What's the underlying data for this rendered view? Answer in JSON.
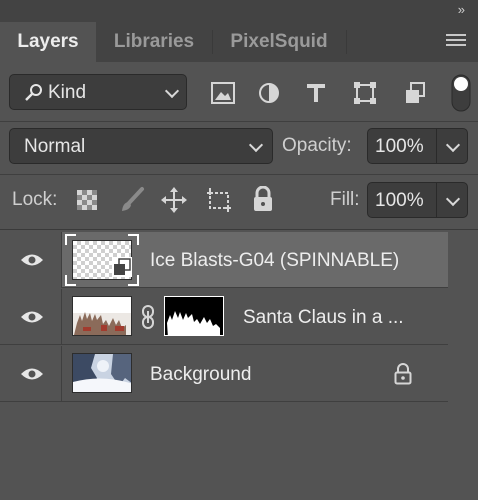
{
  "panel": {
    "collapse_glyph": "»",
    "tabs": [
      {
        "label": "Layers",
        "active": true
      },
      {
        "label": "Libraries",
        "active": false
      },
      {
        "label": "PixelSquid",
        "active": false
      }
    ]
  },
  "filter": {
    "kind_label": "Kind",
    "icons": [
      "image-filter-icon",
      "adjustment-filter-icon",
      "type-filter-icon",
      "shape-filter-icon",
      "smart-object-filter-icon",
      "filter-toggle-icon"
    ]
  },
  "blend": {
    "mode": "Normal",
    "opacity_label": "Opacity:",
    "opacity_value": "100%"
  },
  "lock": {
    "label": "Lock:",
    "fill_label": "Fill:",
    "fill_value": "100%"
  },
  "layers": [
    {
      "name": "Ice Blasts-G04 (SPINNABLE)",
      "selected": true,
      "visible": true,
      "type": "smart-object"
    },
    {
      "name": "Santa Claus in a ...",
      "selected": false,
      "visible": true,
      "type": "masked"
    },
    {
      "name": "Background",
      "selected": false,
      "visible": true,
      "type": "background",
      "locked": true
    }
  ],
  "colors": {
    "panel_bg": "#535353",
    "tab_bar_bg": "#434343",
    "selected_row": "#6a6a6a"
  }
}
